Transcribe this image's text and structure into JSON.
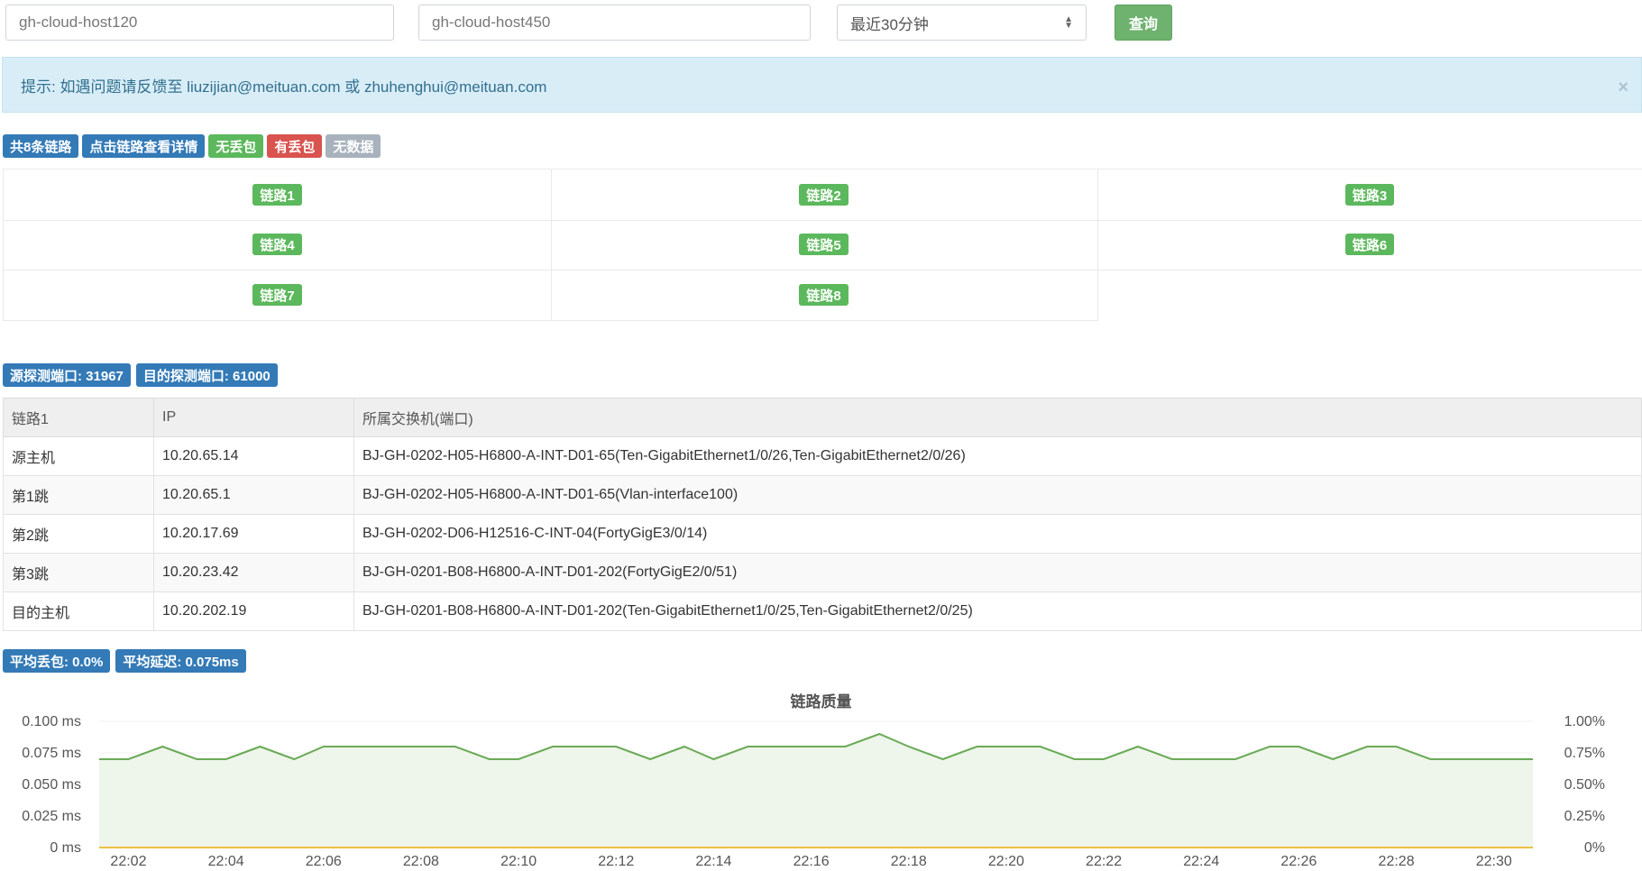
{
  "query": {
    "source_host": "gh-cloud-host120",
    "dest_host": "gh-cloud-host450",
    "time_range": "最近30分钟",
    "submit_label": "查询"
  },
  "alert": {
    "text": "提示:  如遇问题请反馈至 liuzijian@meituan.com 或 zhuhenghui@meituan.com",
    "close": "×"
  },
  "summary_labels": {
    "total": "共8条链路",
    "hint": "点击链路查看详情",
    "no_loss": "无丢包",
    "has_loss": "有丢包",
    "no_data": "无数据"
  },
  "links": [
    "链路1",
    "链路2",
    "链路3",
    "链路4",
    "链路5",
    "链路6",
    "链路7",
    "链路8"
  ],
  "ports": {
    "source": "源探测端口: 31967",
    "dest": "目的探测端口: 61000"
  },
  "route_table": {
    "headers": [
      "链路1",
      "IP",
      "所属交换机(端口)"
    ],
    "rows": [
      [
        "源主机",
        "10.20.65.14",
        "BJ-GH-0202-H05-H6800-A-INT-D01-65(Ten-GigabitEthernet1/0/26,Ten-GigabitEthernet2/0/26)"
      ],
      [
        "第1跳",
        "10.20.65.1",
        "BJ-GH-0202-H05-H6800-A-INT-D01-65(Vlan-interface100)"
      ],
      [
        "第2跳",
        "10.20.17.69",
        "BJ-GH-0202-D06-H12516-C-INT-04(FortyGigE3/0/14)"
      ],
      [
        "第3跳",
        "10.20.23.42",
        "BJ-GH-0201-B08-H6800-A-INT-D01-202(FortyGigE2/0/51)"
      ],
      [
        "目的主机",
        "10.20.202.19",
        "BJ-GH-0201-B08-H6800-A-INT-D01-202(Ten-GigabitEthernet1/0/25,Ten-GigabitEthernet2/0/25)"
      ]
    ]
  },
  "stats": {
    "avg_loss": "平均丢包: 0.0%",
    "avg_latency": "平均延迟: 0.075ms"
  },
  "colors": {
    "latency_line": "#6aaa56",
    "latency_fill": "#eef5ea",
    "loss_line": "#f0c040"
  },
  "chart_data": {
    "type": "line",
    "title": "链路质量",
    "y_left_ticks": [
      "0.100 ms",
      "0.075 ms",
      "0.050 ms",
      "0.025 ms",
      "0 ms"
    ],
    "y_right_ticks": [
      "1.00%",
      "0.75%",
      "0.50%",
      "0.25%",
      "0%"
    ],
    "ylim_left": [
      0,
      0.1
    ],
    "ylim_right": [
      0,
      1
    ],
    "x_tick_labels": [
      "22:02",
      "22:04",
      "22:06",
      "22:08",
      "22:10",
      "22:12",
      "22:14",
      "22:16",
      "22:18",
      "22:20",
      "22:22",
      "22:24",
      "22:26",
      "22:28",
      "22:30"
    ],
    "x_tick_minutes": [
      2,
      4,
      6,
      8,
      10,
      12,
      14,
      16,
      18,
      20,
      22,
      24,
      26,
      28,
      30
    ],
    "x_minutes": [
      1.4,
      2,
      2.7,
      3.4,
      4,
      4.7,
      5.4,
      6,
      6.7,
      7.4,
      8,
      8.7,
      9.4,
      10,
      10.7,
      11.4,
      12,
      12.7,
      13.4,
      14,
      14.7,
      15.4,
      16,
      16.7,
      17.4,
      18,
      18.7,
      19.4,
      20,
      20.7,
      21.4,
      22,
      22.7,
      23.4,
      24,
      24.7,
      25.4,
      26,
      26.7,
      27.4,
      28,
      28.7,
      29.4,
      30,
      30.8
    ],
    "series": [
      {
        "name": "",
        "axis": "left",
        "values": [
          0.07,
          0.07,
          0.08,
          0.07,
          0.07,
          0.08,
          0.07,
          0.08,
          0.08,
          0.08,
          0.08,
          0.08,
          0.07,
          0.07,
          0.08,
          0.08,
          0.08,
          0.07,
          0.08,
          0.07,
          0.08,
          0.08,
          0.08,
          0.08,
          0.09,
          0.08,
          0.07,
          0.08,
          0.08,
          0.08,
          0.07,
          0.07,
          0.08,
          0.07,
          0.07,
          0.07,
          0.08,
          0.08,
          0.07,
          0.08,
          0.08,
          0.07,
          0.07,
          0.07,
          0.07
        ]
      },
      {
        "name": "",
        "axis": "right",
        "values": [
          0,
          0,
          0,
          0,
          0,
          0,
          0,
          0,
          0,
          0,
          0,
          0,
          0,
          0,
          0,
          0,
          0,
          0,
          0,
          0,
          0,
          0,
          0,
          0,
          0,
          0,
          0,
          0,
          0,
          0,
          0,
          0,
          0,
          0,
          0,
          0,
          0,
          0,
          0,
          0,
          0,
          0,
          0,
          0,
          0
        ]
      }
    ]
  }
}
